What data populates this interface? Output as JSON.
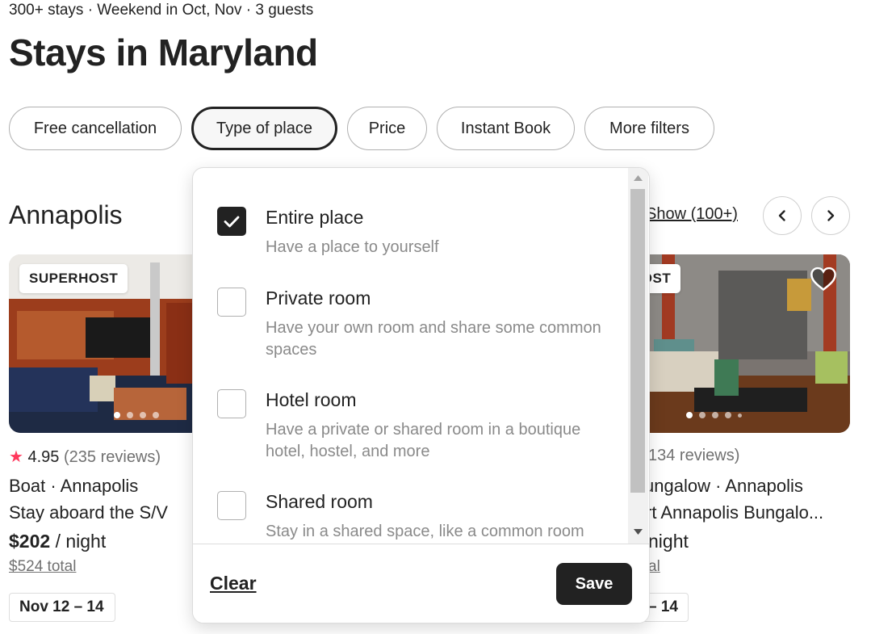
{
  "header": {
    "summary": "300+ stays · Weekend in Oct, Nov · 3 guests",
    "title": "Stays in Maryland"
  },
  "filters": {
    "free_cancellation": "Free cancellation",
    "type_of_place": "Type of place",
    "price": "Price",
    "instant_book": "Instant Book",
    "more_filters": "More filters"
  },
  "section": {
    "title": "Annapolis",
    "show_all": "Show (100+)",
    "prev_icon": "chevron-left-icon",
    "next_icon": "chevron-right-icon"
  },
  "listings": [
    {
      "badge": "SUPERHOST",
      "rating": "4.95",
      "reviews": "(235 reviews)",
      "type_location": "Boat · Annapolis",
      "name": "Stay aboard the S/V",
      "price": "$202",
      "per_night": "/ night",
      "total": "$524 total",
      "dates": "Nov 12 – 14"
    },
    {
      "badge": "HOST",
      "reviews": "134 reviews)",
      "type_location": "ungalow · Annapolis",
      "name": "rt Annapolis Bungalo...",
      "per_night": "night",
      "total": "al",
      "dates": "– 14"
    }
  ],
  "type_of_place_dropdown": {
    "options": [
      {
        "label": "Entire place",
        "description": "Have a place to yourself",
        "checked": true
      },
      {
        "label": "Private room",
        "description": "Have your own room and share some common spaces",
        "checked": false
      },
      {
        "label": "Hotel room",
        "description": "Have a private or shared room in a boutique hotel, hostel, and more",
        "checked": false
      },
      {
        "label": "Shared room",
        "description": "Stay in a shared space, like a common room",
        "checked": false
      }
    ],
    "clear_label": "Clear",
    "save_label": "Save"
  },
  "colors": {
    "text": "#222222",
    "muted": "#717171",
    "star": "#ff385c",
    "save_bg": "#222222"
  }
}
